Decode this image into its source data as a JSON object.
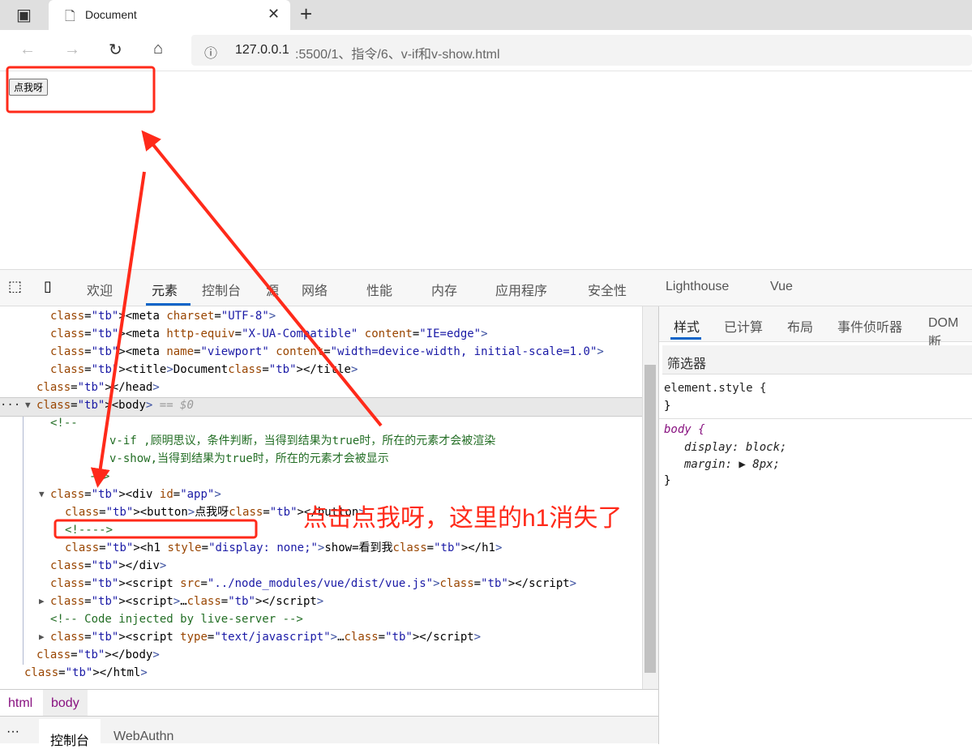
{
  "browser": {
    "tab_title": "Document",
    "url_host": "127.0.0.1",
    "url_rest": ":5500/1、指令/6、v-if和v-show.html"
  },
  "page": {
    "button_label": "点我呀"
  },
  "devtools": {
    "tabs": [
      "欢迎",
      "元素",
      "控制台",
      "源",
      "网络",
      "性能",
      "内存",
      "应用程序",
      "安全性",
      "Lighthouse",
      "Vue"
    ],
    "active_tab": "元素",
    "code_lines": [
      "<meta charset=\"UTF-8\">",
      "<meta http-equiv=\"X-UA-Compatible\" content=\"IE=edge\">",
      "<meta name=\"viewport\" content=\"width=device-width, initial-scale=1.0\">",
      "<title>Document</title>",
      "</head>",
      "<body> == $0",
      "<!--",
      "v-if ,顾明思议，条件判断，当得到结果为true时，所在的元素才会被渲染",
      "v-show,当得到结果为true时，所在的元素才会被显示",
      "-->",
      "<div id=\"app\">",
      "<button>点我呀</button>",
      "<!---->",
      "<h1 style=\"display: none;\">show=看到我</h1>",
      "</div>",
      "<script src=\"../node_modules/vue/dist/vue.js\"></script>",
      "<script>…</script>",
      "<!-- Code injected by live-server -->",
      "<script type=\"text/javascript\">…</script>",
      "</body>",
      "</html>"
    ],
    "breadcrumbs": [
      "html",
      "body"
    ],
    "styles_tabs": [
      "样式",
      "已计算",
      "布局",
      "事件侦听器",
      "DOM 断"
    ],
    "filter_placeholder": "筛选器",
    "element_style": "element.style {",
    "close_brace": "}",
    "body_rule": "body {",
    "display_prop": "display: block;",
    "margin_prop": "margin: ▶ 8px;",
    "drawer_tabs": [
      "控制台",
      "WebAuthn"
    ],
    "drawer_more": "···",
    "more": "···"
  },
  "annotation": {
    "text": "点击点我呀，这里的h1消失了",
    "color": "#ff2a1a"
  }
}
